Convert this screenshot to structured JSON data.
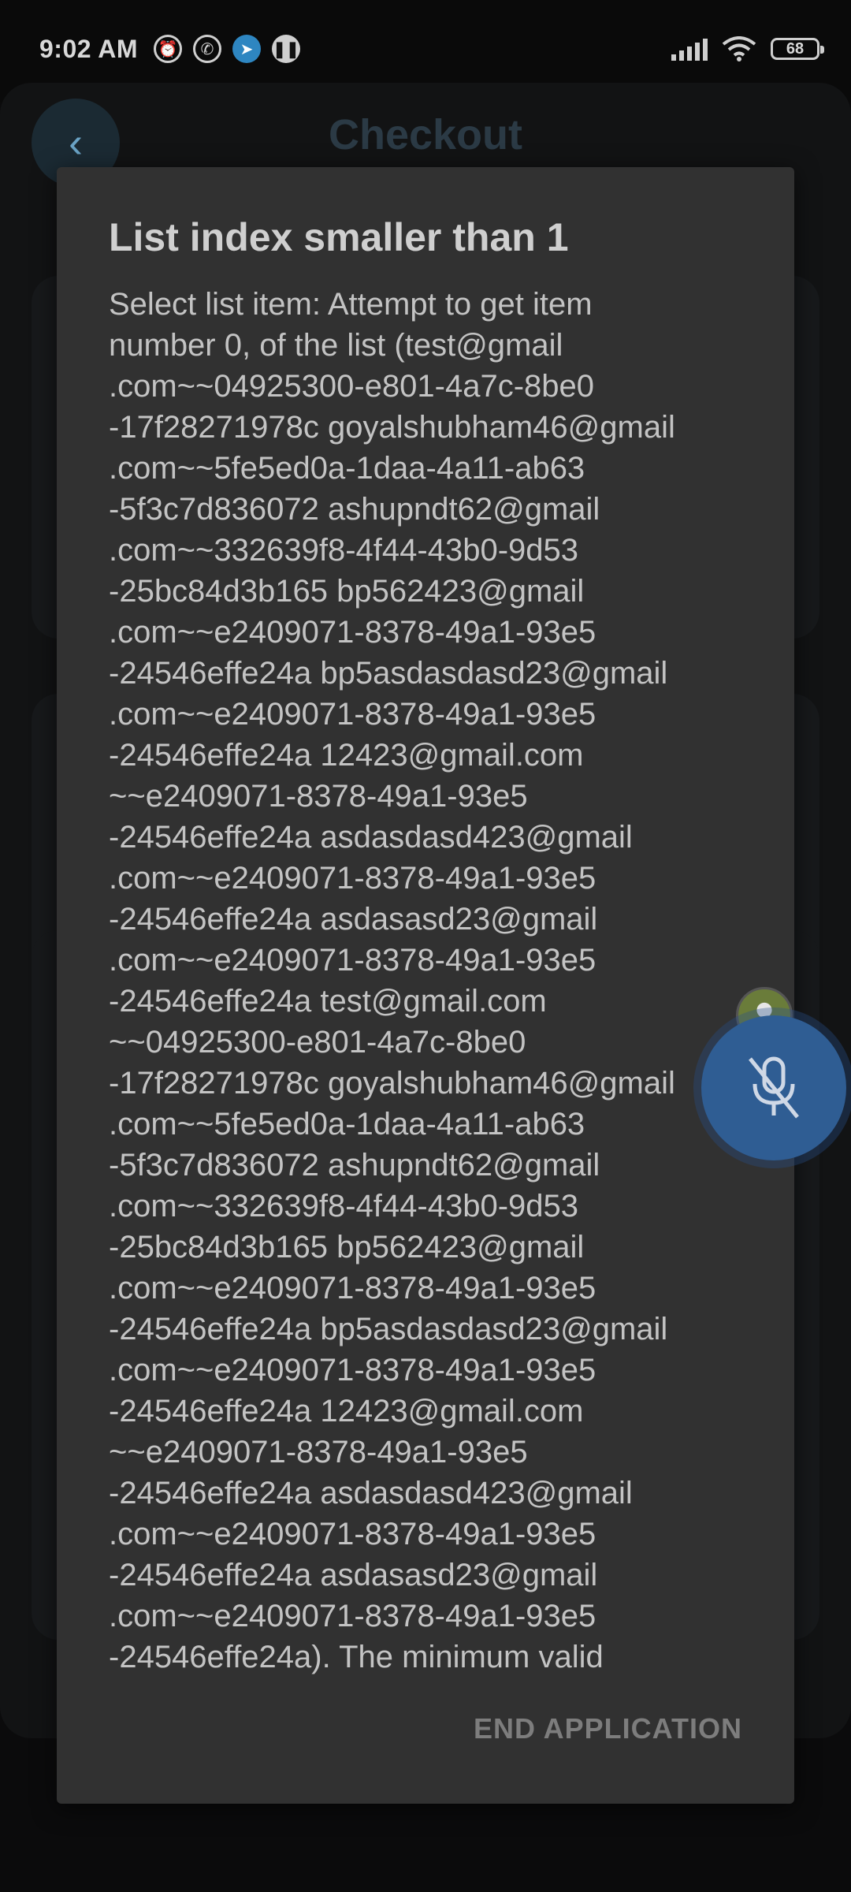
{
  "status_bar": {
    "time": "9:02 AM",
    "notification_icons": [
      "alarm-icon",
      "whatsapp-icon",
      "telegram-icon",
      "pause-icon"
    ],
    "battery_level": "68"
  },
  "app": {
    "title": "Checkout"
  },
  "dialog": {
    "title": "List index smaller than 1",
    "message": "Select list item: Attempt to get item\nnumber 0, of the list (test@gmail\n.com~~04925300-e801-4a7c-8be0\n-17f28271978c goyalshubham46@gmail\n.com~~5fe5ed0a-1daa-4a11-ab63\n-5f3c7d836072 ashupndt62@gmail\n.com~~332639f8-4f44-43b0-9d53\n-25bc84d3b165 bp562423@gmail\n.com~~e2409071-8378-49a1-93e5\n-24546effe24a bp5asdasdasd23@gmail\n.com~~e2409071-8378-49a1-93e5\n-24546effe24a 12423@gmail.com\n~~e2409071-8378-49a1-93e5\n-24546effe24a asdasdasd423@gmail\n.com~~e2409071-8378-49a1-93e5\n-24546effe24a asdasasd23@gmail\n.com~~e2409071-8378-49a1-93e5\n-24546effe24a test@gmail.com\n~~04925300-e801-4a7c-8be0\n-17f28271978c goyalshubham46@gmail\n.com~~5fe5ed0a-1daa-4a11-ab63\n-5f3c7d836072 ashupndt62@gmail\n.com~~332639f8-4f44-43b0-9d53\n-25bc84d3b165 bp562423@gmail\n.com~~e2409071-8378-49a1-93e5\n-24546effe24a bp5asdasdasd23@gmail\n.com~~e2409071-8378-49a1-93e5\n-24546effe24a 12423@gmail.com\n~~e2409071-8378-49a1-93e5\n-24546effe24a asdasdasd423@gmail\n.com~~e2409071-8378-49a1-93e5\n-24546effe24a asdasasd23@gmail\n.com~~e2409071-8378-49a1-93e5\n-24546effe24a). The minimum valid",
    "button_label": "END APPLICATION"
  },
  "overlay": {
    "mic_icon": "mic-off-icon"
  },
  "colors": {
    "dialog_bg": "#313131",
    "mic_bubble": "#2f5d93"
  }
}
